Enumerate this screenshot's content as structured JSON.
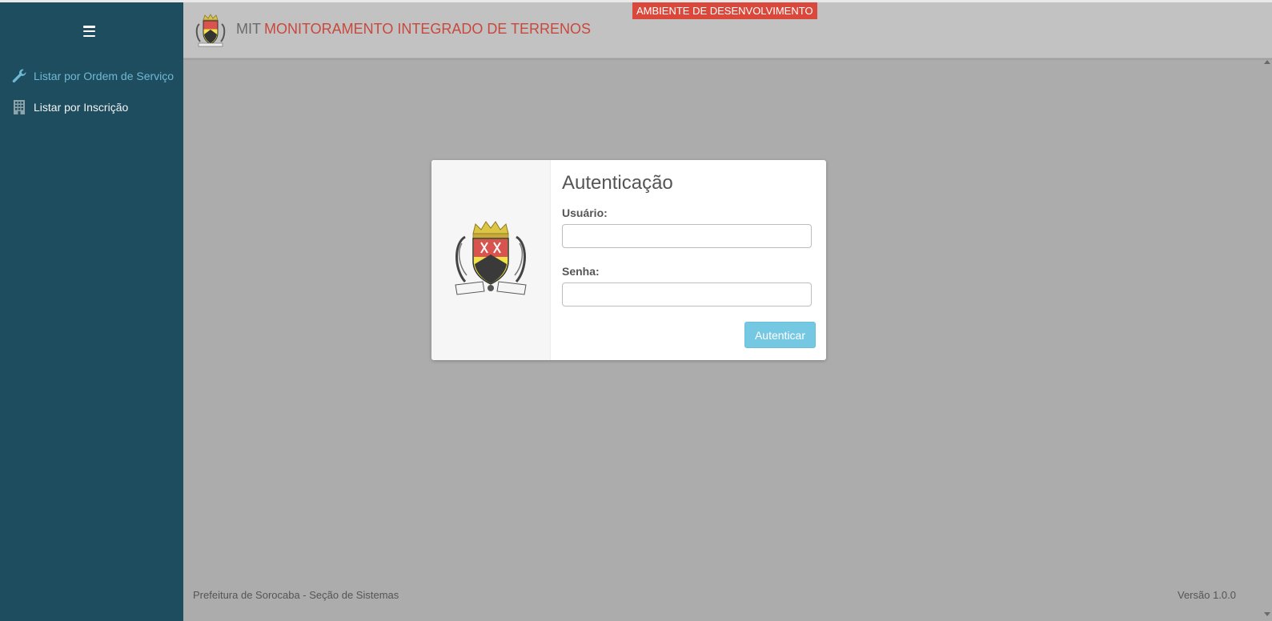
{
  "sidebar": {
    "items": [
      {
        "label": "Listar por Ordem de Serviço",
        "icon": "wrench-icon"
      },
      {
        "label": "Listar por Inscrição",
        "icon": "building-icon"
      }
    ]
  },
  "header": {
    "title_prefix": "MIT",
    "title_main": "MONITORAMENTO INTEGRADO DE TERRENOS",
    "env_badge": "AMBIENTE DE DESENVOLVIMENTO"
  },
  "login": {
    "title": "Autenticação",
    "username_label": "Usuário:",
    "username_value": "",
    "password_label": "Senha:",
    "password_value": "",
    "submit_label": "Autenticar"
  },
  "footer": {
    "left": "Prefeitura de Sorocaba - Seção de Sistemas",
    "right": "Versão 1.0.0"
  },
  "colors": {
    "sidebar_bg": "#1e4d5f",
    "header_bg": "#c2c2c2",
    "page_bg": "#acacac",
    "accent_red": "#c9483d",
    "badge_bg": "#d9483b",
    "button_bg": "#75c8e2",
    "active_link": "#6fb9d4"
  }
}
